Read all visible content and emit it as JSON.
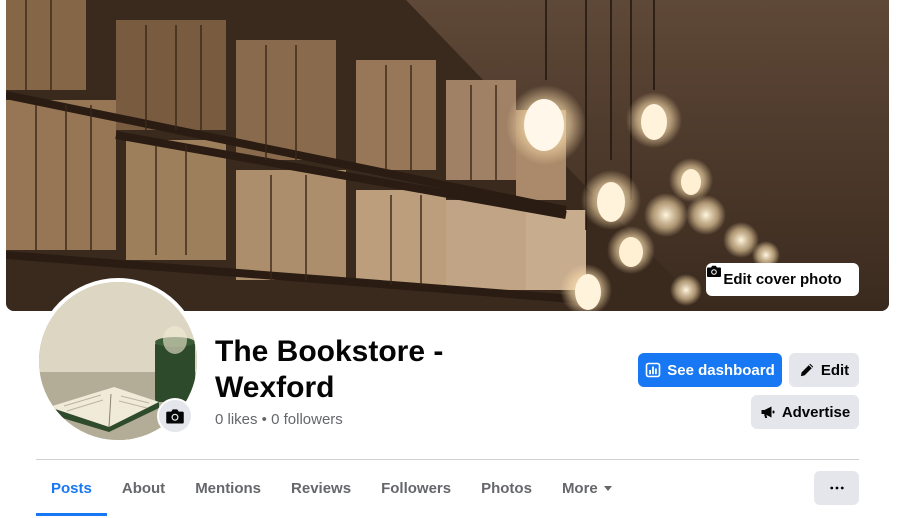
{
  "cover": {
    "edit_label": "Edit cover photo",
    "edit_icon": "camera-icon"
  },
  "profile": {
    "title": "The Bookstore - Wexford",
    "stats": "0 likes • 0 followers",
    "avatar_camera_icon": "camera-icon"
  },
  "actions": {
    "dashboard_label": "See dashboard",
    "dashboard_icon": "bar-chart-icon",
    "edit_label": "Edit",
    "edit_icon": "pencil-icon",
    "advertise_label": "Advertise",
    "advertise_icon": "megaphone-icon"
  },
  "tabs": [
    {
      "label": "Posts",
      "active": true
    },
    {
      "label": "About",
      "active": false
    },
    {
      "label": "Mentions",
      "active": false
    },
    {
      "label": "Reviews",
      "active": false
    },
    {
      "label": "Followers",
      "active": false
    },
    {
      "label": "Photos",
      "active": false
    },
    {
      "label": "More",
      "active": false
    }
  ],
  "more_menu_icon": "more-dots-icon",
  "colors": {
    "primary": "#1877f2",
    "secondary_bg": "#e4e6eb",
    "muted_text": "#65676b",
    "text": "#050505"
  }
}
